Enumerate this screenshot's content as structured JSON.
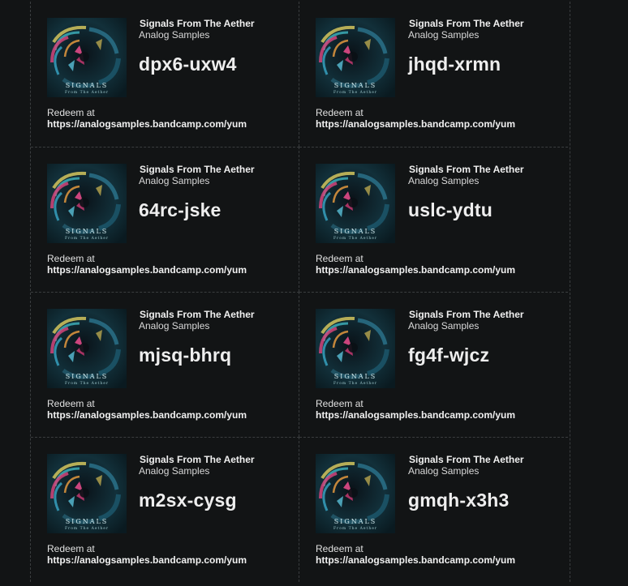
{
  "cards": [
    {
      "album_title": "Signals From The Aether",
      "artist": "Analog Samples",
      "code": "dpx6-uxw4",
      "redeem_label": "Redeem at",
      "redeem_url": "https://analogsamples.bandcamp.com/yum",
      "cover_text": "SIGNALS",
      "cover_subtext": "From The Aether"
    },
    {
      "album_title": "Signals From The Aether",
      "artist": "Analog Samples",
      "code": "jhqd-xrmn",
      "redeem_label": "Redeem at",
      "redeem_url": "https://analogsamples.bandcamp.com/yum",
      "cover_text": "SIGNALS",
      "cover_subtext": "From The Aether"
    },
    {
      "album_title": "Signals From The Aether",
      "artist": "Analog Samples",
      "code": "64rc-jske",
      "redeem_label": "Redeem at",
      "redeem_url": "https://analogsamples.bandcamp.com/yum",
      "cover_text": "SIGNALS",
      "cover_subtext": "From The Aether"
    },
    {
      "album_title": "Signals From The Aether",
      "artist": "Analog Samples",
      "code": "uslc-ydtu",
      "redeem_label": "Redeem at",
      "redeem_url": "https://analogsamples.bandcamp.com/yum",
      "cover_text": "SIGNALS",
      "cover_subtext": "From The Aether"
    },
    {
      "album_title": "Signals From The Aether",
      "artist": "Analog Samples",
      "code": "mjsq-bhrq",
      "redeem_label": "Redeem at",
      "redeem_url": "https://analogsamples.bandcamp.com/yum",
      "cover_text": "SIGNALS",
      "cover_subtext": "From The Aether"
    },
    {
      "album_title": "Signals From The Aether",
      "artist": "Analog Samples",
      "code": "fg4f-wjcz",
      "redeem_label": "Redeem at",
      "redeem_url": "https://analogsamples.bandcamp.com/yum",
      "cover_text": "SIGNALS",
      "cover_subtext": "From The Aether"
    },
    {
      "album_title": "Signals From The Aether",
      "artist": "Analog Samples",
      "code": "m2sx-cysg",
      "redeem_label": "Redeem at",
      "redeem_url": "https://analogsamples.bandcamp.com/yum",
      "cover_text": "SIGNALS",
      "cover_subtext": "From The Aether"
    },
    {
      "album_title": "Signals From The Aether",
      "artist": "Analog Samples",
      "code": "gmqh-x3h3",
      "redeem_label": "Redeem at",
      "redeem_url": "https://analogsamples.bandcamp.com/yum",
      "cover_text": "SIGNALS",
      "cover_subtext": "From The Aether"
    }
  ],
  "colors": {
    "background": "#121415",
    "divider": "#3a3d3f",
    "text": "#eeeeee",
    "cover_bg": "#0b1c24"
  },
  "icons": {
    "cover": "album-cover-image"
  }
}
